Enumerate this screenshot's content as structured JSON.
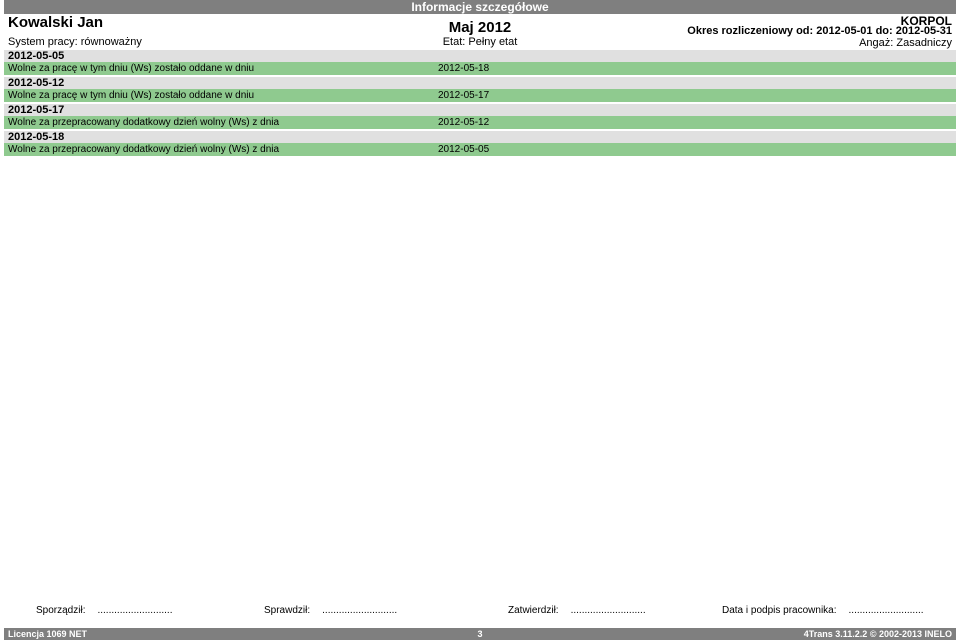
{
  "report_title": "Informacje szczegółowe",
  "header": {
    "employee_name": "Kowalski Jan",
    "work_system": "System pracy: równoważny",
    "month": "Maj 2012",
    "etat": "Etat: Pełny etat",
    "company": "KORPOL",
    "period": "Okres rozliczeniowy od: 2012-05-01 do: 2012-05-31",
    "angaz": "Angaż: Zasadniczy"
  },
  "records": [
    {
      "date": "2012-05-05",
      "description": "Wolne za pracę w tym dniu (Ws) zostało oddane w dniu",
      "related_date": "2012-05-18"
    },
    {
      "date": "2012-05-12",
      "description": "Wolne za pracę w tym dniu (Ws) zostało oddane w dniu",
      "related_date": "2012-05-17"
    },
    {
      "date": "2012-05-17",
      "description": "Wolne za przepracowany dodatkowy dzień wolny (Ws) z dnia",
      "related_date": "2012-05-12"
    },
    {
      "date": "2012-05-18",
      "description": "Wolne za przepracowany dodatkowy dzień wolny (Ws) z dnia",
      "related_date": "2012-05-05"
    }
  ],
  "signatures": {
    "prepared": "Sporządził:",
    "checked": "Sprawdził:",
    "approved": "Zatwierdził:",
    "employee": "Data i podpis pracownika:",
    "dots": "..........................."
  },
  "footer": {
    "license": "Licencja 1069 NET",
    "page": "3",
    "version": "4Trans 3.11.2.2 © 2002-2013 INELO"
  },
  "colors": {
    "bar_gray": "#7f7f7f",
    "date_row": "#e0e0e0",
    "detail_row": "#8fca8f"
  }
}
